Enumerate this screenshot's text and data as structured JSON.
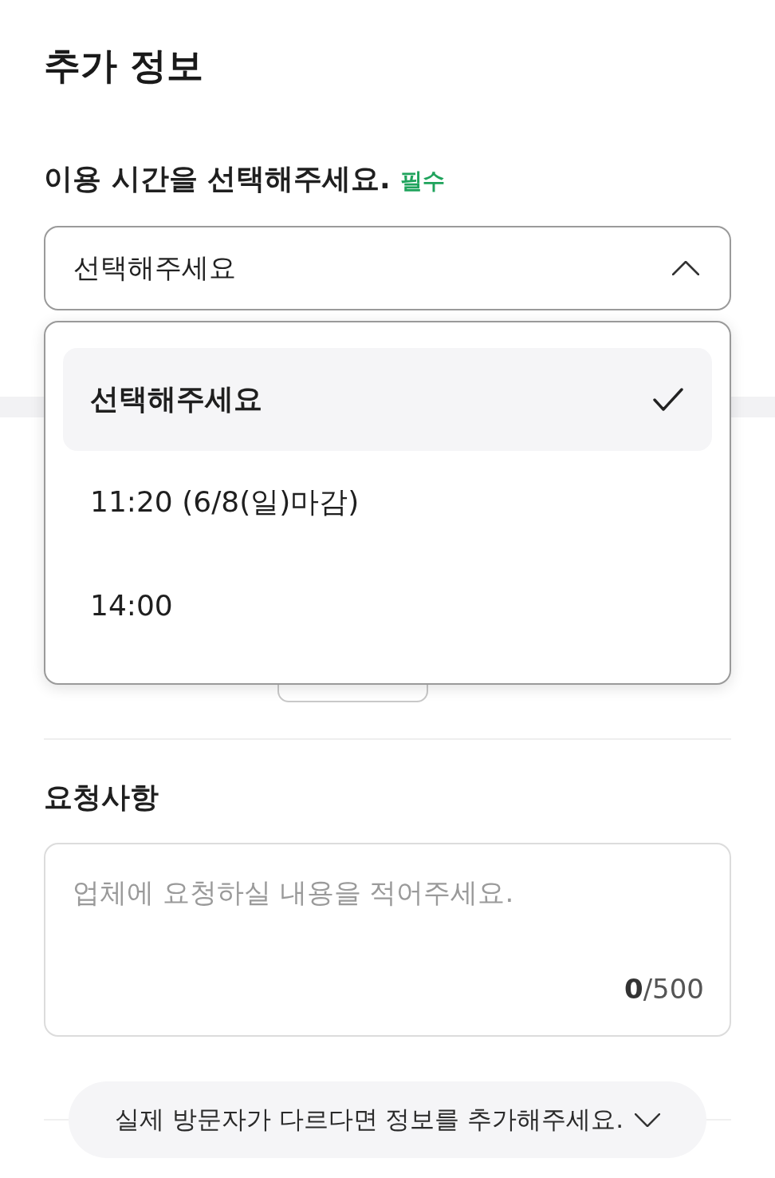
{
  "page": {
    "title": "추가 정보"
  },
  "time_field": {
    "label": "이용 시간을 선택해주세요.",
    "required_badge": "필수",
    "value": "선택해주세요",
    "expanded": true,
    "options": [
      {
        "label": "선택해주세요",
        "selected": true
      },
      {
        "label": "11:20 (6/8(일)마감)",
        "selected": false
      },
      {
        "label": "14:00",
        "selected": false
      }
    ]
  },
  "request_field": {
    "label": "요청사항",
    "placeholder": "업체에 요청하실 내용을 적어주세요.",
    "counter": "**0**/500"
  },
  "visitor_toggle": {
    "label": "실제 방문자가 다르다면 정보를 추가해주세요.",
    "expanded": false
  }
}
